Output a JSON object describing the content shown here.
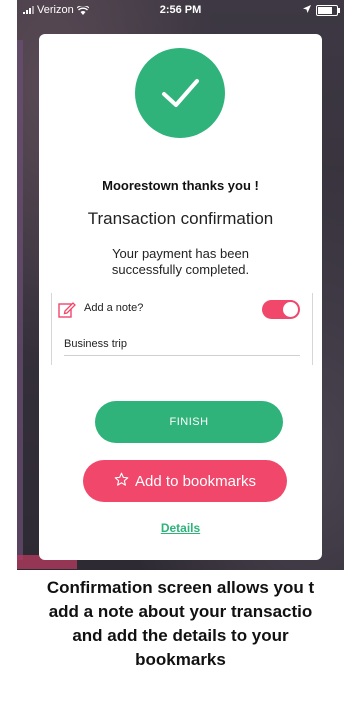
{
  "status_bar": {
    "carrier": "Verizon",
    "time": "2:56 PM"
  },
  "confirmation": {
    "thanks": "Moorestown thanks you !",
    "title": "Transaction confirmation",
    "message": "Your payment has been successfully completed."
  },
  "note": {
    "label": "Add a note?",
    "toggle_on": true,
    "value": "Business trip"
  },
  "buttons": {
    "finish": "FINISH",
    "bookmark": "Add to bookmarks",
    "details": "Details"
  },
  "colors": {
    "success_green": "#2fb37a",
    "accent_pink": "#f0476b"
  },
  "caption": {
    "line1": "Confirmation screen allows you t",
    "line2": "add a note about your transactio",
    "line3": "and add the details to your",
    "line4": "bookmarks"
  }
}
